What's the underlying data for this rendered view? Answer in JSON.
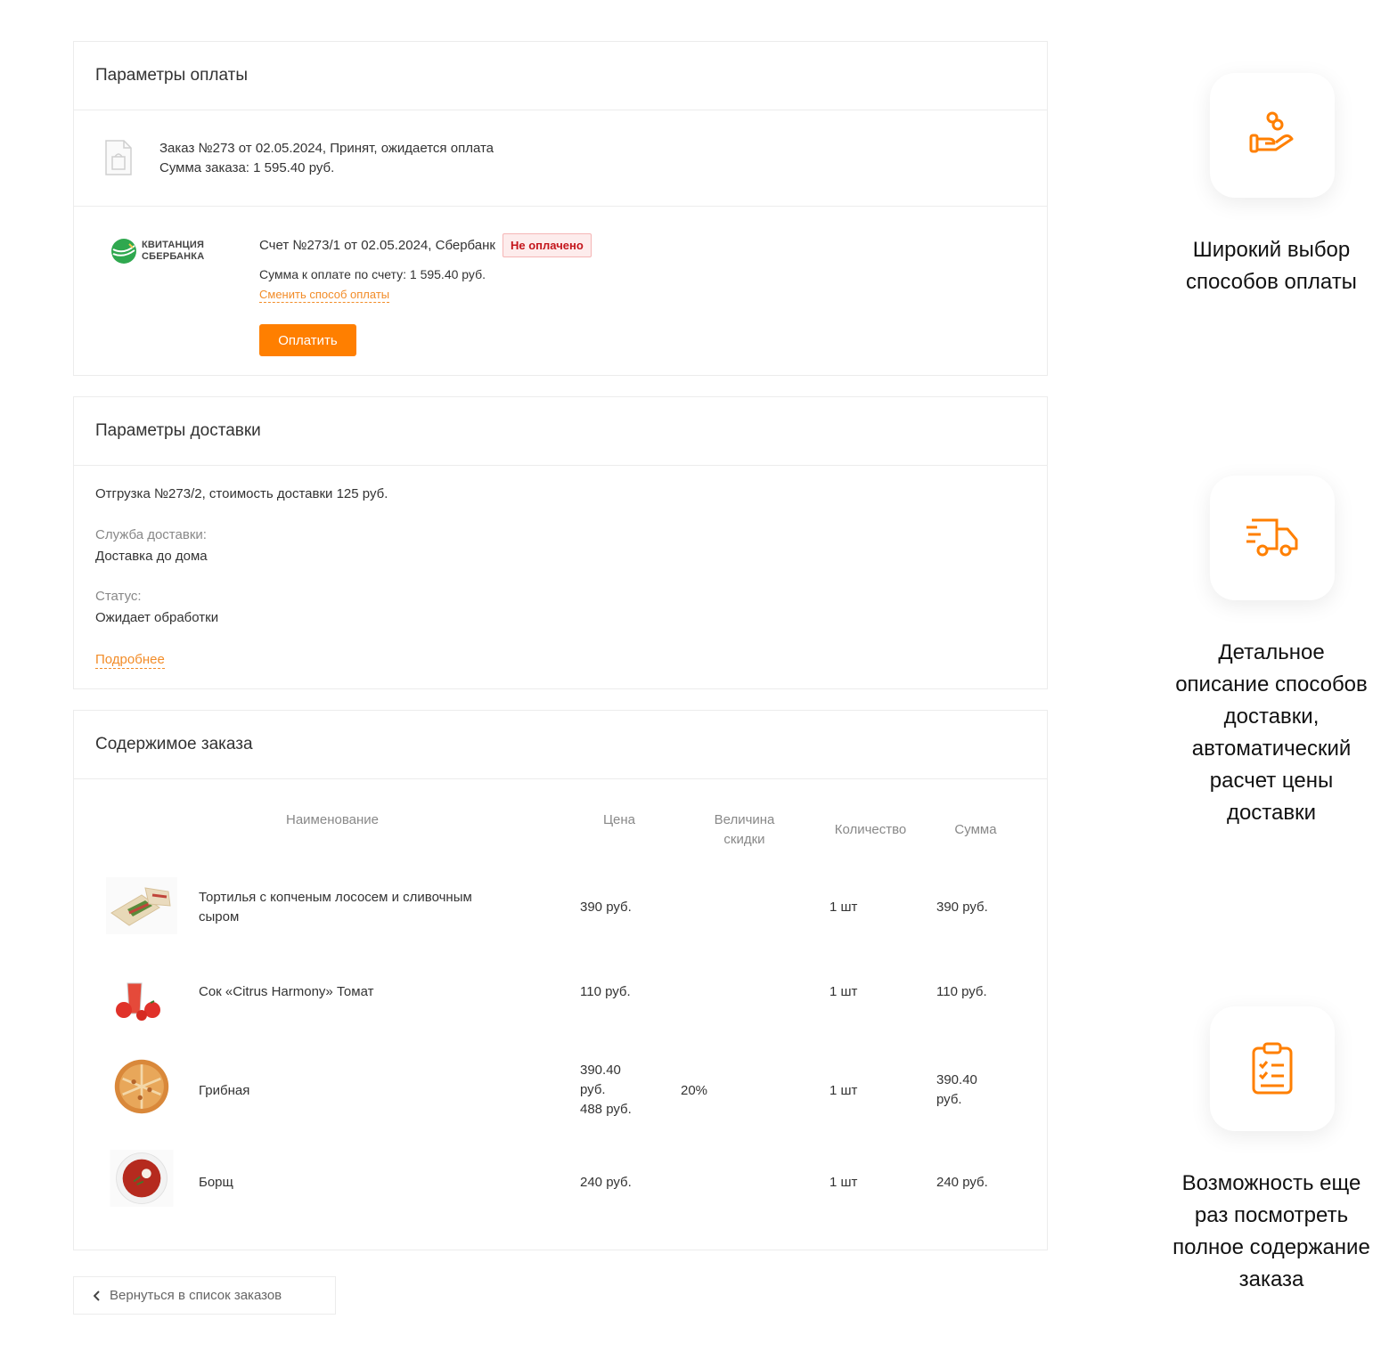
{
  "payment": {
    "title": "Параметры оплаты",
    "order_line1": "Заказ №273 от 02.05.2024, Принят, ожидается оплата",
    "order_line2": "Сумма заказа: 1 595.40 руб.",
    "logo_line1": "КВИТАНЦИЯ",
    "logo_line2": "СБЕРБАНКА",
    "bill_title": "Счет №273/1 от 02.05.2024, Сбербанк",
    "status_badge": "Не оплачено",
    "bill_sum": "Сумма к оплате по счету: 1 595.40 руб.",
    "change_link": "Сменить способ оплаты",
    "pay_button": "Оплатить"
  },
  "delivery": {
    "title": "Параметры доставки",
    "shipment": "Отгрузка №273/2, стоимость доставки 125 руб.",
    "service_label": "Служба доставки:",
    "service_value": "Доставка до дома",
    "status_label": "Статус:",
    "status_value": "Ожидает обработки",
    "more_link": "Подробнее"
  },
  "content": {
    "title": "Содержимое заказа",
    "headers": {
      "name": "Наименование",
      "price": "Цена",
      "discount_line1": "Величина",
      "discount_line2": "скидки",
      "quantity": "Количество",
      "sum": "Сумма"
    },
    "items": [
      {
        "name_line1": "Тортилья с копченым лососем и сливочным",
        "name_line2": "сыром",
        "price": "390 руб.",
        "discount": "",
        "quantity": "1 шт",
        "sum": "390 руб.",
        "image": "tortilla-image"
      },
      {
        "name_line1": "Сок «Citrus Harmony» Томат",
        "name_line2": "",
        "price": "110 руб.",
        "discount": "",
        "quantity": "1 шт",
        "sum": "110 руб.",
        "image": "tomato-juice-image"
      },
      {
        "name_line1": "Грибная",
        "name_line2": "",
        "price_line1": "390.40",
        "price_line2": "руб.",
        "price_old": "488 руб.",
        "discount": "20%",
        "quantity": "1 шт",
        "sum_line1": "390.40",
        "sum_line2": "руб.",
        "image": "pizza-image"
      },
      {
        "name_line1": "Борщ",
        "name_line2": "",
        "price": "240 руб.",
        "discount": "",
        "quantity": "1 шт",
        "sum": "240 руб.",
        "image": "borscht-image"
      }
    ]
  },
  "back_button": "Вернуться в список заказов",
  "features": [
    {
      "icon": "hand-coins-icon",
      "line1": "Широкий выбор",
      "line2": "способов оплаты"
    },
    {
      "icon": "delivery-truck-icon",
      "line1": "Детальное",
      "line2": "описание способов",
      "line3": "доставки,",
      "line4": "автоматический",
      "line5": "расчет цены",
      "line6": "доставки"
    },
    {
      "icon": "clipboard-checklist-icon",
      "line1": "Возможность еще",
      "line2": "раз посмотреть",
      "line3": "полное содержание",
      "line4": "заказа"
    }
  ],
  "colors": {
    "accent": "#ff7f00",
    "link": "#f28c28",
    "badge_bg": "#fdecec",
    "badge_text": "#c4161c",
    "border": "#ececec"
  }
}
